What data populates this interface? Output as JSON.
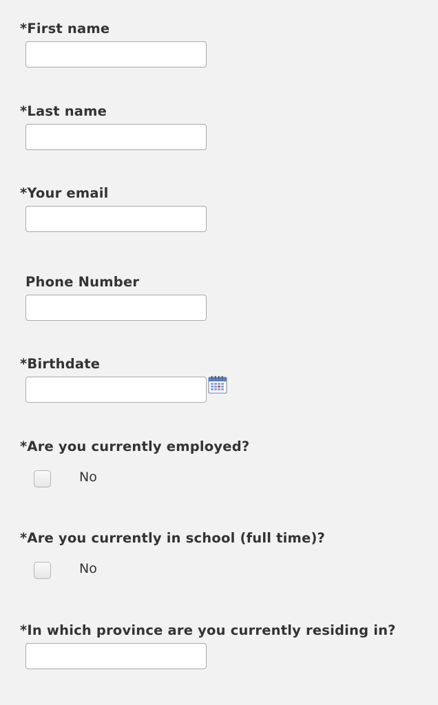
{
  "fields": {
    "first_name": {
      "label": "*First name",
      "value": ""
    },
    "last_name": {
      "label": "*Last name",
      "value": ""
    },
    "email": {
      "label": "*Your email",
      "value": ""
    },
    "phone": {
      "label": "Phone Number",
      "value": ""
    },
    "birthdate": {
      "label": "*Birthdate",
      "value": "",
      "icon": "calendar-icon"
    },
    "employed": {
      "label": "*Are you currently employed?",
      "option_label": "No",
      "checked": false
    },
    "in_school": {
      "label": "*Are you currently in school (full time)?",
      "option_label": "No",
      "checked": false
    },
    "province": {
      "label": "*In which province are you currently residing in?",
      "value": ""
    }
  }
}
